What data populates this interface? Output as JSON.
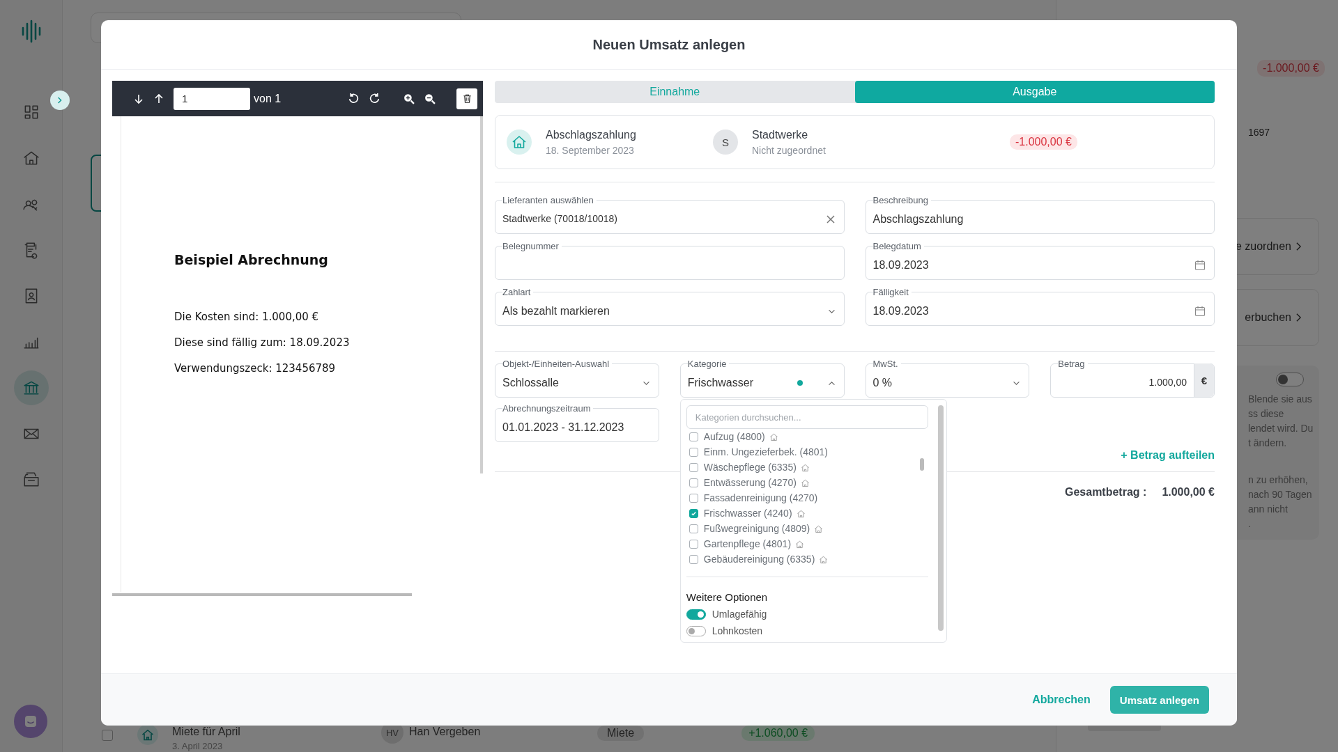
{
  "background": {
    "sidebar": {
      "items": [
        {
          "selected": false
        },
        {
          "selected": false
        },
        {
          "selected": false
        },
        {
          "selected": false
        },
        {
          "selected": false
        },
        {
          "selected": false
        },
        {
          "selected": true
        },
        {
          "selected": false
        },
        {
          "selected": false
        }
      ]
    },
    "list_row": {
      "checked": false,
      "title": "Miete für April",
      "date": "3. April 2023",
      "initials": "HV",
      "person": "Han Vergeben",
      "tag": "Miete",
      "amount": "+1.060,00 €"
    },
    "right_panel": {
      "amount": "-1.000,00 €",
      "number": "1697",
      "cards": [
        {
          "label": "e zuordnen"
        },
        {
          "label": "erbuchen"
        }
      ],
      "toggle_on": false,
      "note_lines": [
        "Blende sie aus",
        "ss diese",
        "lendet wird. Du",
        "t ändern."
      ],
      "note_lines_2": [
        "n zu erhöhen,",
        "nach 90 Tagen",
        "ann nicht",
        "."
      ]
    }
  },
  "modal": {
    "title": "Neuen Umsatz anlegen",
    "viewer": {
      "page": "1",
      "page_count": "von 1",
      "document": {
        "title": "Beispiel Abrechnung",
        "lines": [
          "Die Kosten sind: 1.000,00 €",
          "Diese sind fällig zum: 18.09.2023",
          "Verwendungszeck: 123456789"
        ]
      }
    },
    "tabs": [
      {
        "label": "Einnahme",
        "selected": false
      },
      {
        "label": "Ausgabe",
        "selected": true
      }
    ],
    "summary": {
      "title": "Abschlagszahlung",
      "date": "18. September 2023",
      "initial": "S",
      "partner": "Stadtwerke",
      "partner_status": "Nicht zugeordnet",
      "amount": "-1.000,00 €"
    },
    "fields": [
      {
        "kind": "clearable",
        "label": "Lieferanten auswählen",
        "value": "Stadtwerke (70018/10018)"
      },
      {
        "kind": "text",
        "label": "Beschreibung",
        "value": "Abschlagszahlung"
      },
      {
        "kind": "text",
        "label": "Belegnummer"
      },
      {
        "kind": "date",
        "label": "Belegdatum",
        "value": "18.09.2023"
      },
      {
        "kind": "select",
        "label": "Zahlart",
        "value": "Als bezahlt markieren"
      },
      {
        "kind": "date",
        "label": "Fälligkeit",
        "value": "18.09.2023"
      }
    ],
    "object": {
      "label": "Objekt-/Einheiten-Auswahl",
      "value": "Schlossalle"
    },
    "category": {
      "label": "Kategorie",
      "value": "Frischwasser",
      "expanded": true,
      "dropdown": {
        "placeholder": "Kategorien durchsuchen...",
        "items": [
          {
            "label": "Aufzug (4800)",
            "checked": false,
            "apportionable": true
          },
          {
            "label": "Einm. Ungezieferbek. (4801)",
            "checked": false,
            "apportionable": false
          },
          {
            "label": "Wäschepflege (6335)",
            "checked": false,
            "apportionable": true
          },
          {
            "label": "Entwässerung (4270)",
            "checked": false,
            "apportionable": true
          },
          {
            "label": "Fassadenreinigung (4270)",
            "checked": false,
            "apportionable": false
          },
          {
            "label": "Frischwasser (4240)",
            "checked": true,
            "apportionable": true
          },
          {
            "label": "Fußwegreinigung (4809)",
            "checked": false,
            "apportionable": true
          },
          {
            "label": "Gartenpflege (4801)",
            "checked": false,
            "apportionable": true
          },
          {
            "label": "Gebäudereinigung (6335)",
            "checked": false,
            "apportionable": true
          }
        ],
        "options_title": "Weitere Optionen",
        "toggles": [
          {
            "label": "Umlagefähig",
            "on": true
          },
          {
            "label": "Lohnkosten",
            "on": false
          }
        ]
      }
    },
    "vat": {
      "label": "MwSt.",
      "value": "0 %"
    },
    "amount": {
      "label": "Betrag",
      "value": "1.000,00",
      "currency": "€"
    },
    "period": {
      "label": "Abrechnungszeitraum",
      "value": "01.01.2023 - 31.12.2023"
    },
    "split_link": "+ Betrag aufteilen",
    "total": {
      "label": "Gesamtbetrag :",
      "value": "1.000,00 €"
    },
    "buttons": {
      "cancel": "Abbrechen",
      "submit": "Umsatz anlegen"
    }
  }
}
